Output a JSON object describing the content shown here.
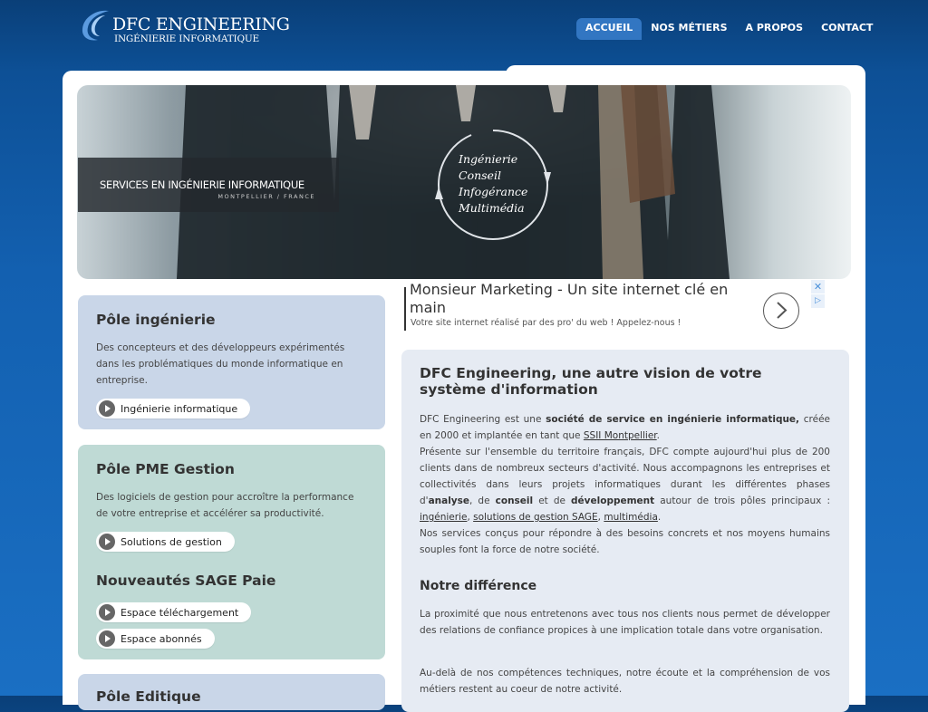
{
  "header": {
    "brand": "DFC ENGINEERING",
    "tagline": "INGÉNIERIE INFORMATIQUE",
    "nav": [
      "ACCUEIL",
      "NOS MÉTIERS",
      "A PROPOS",
      "CONTACT"
    ]
  },
  "banner": {
    "caption_main": "SERVICES EN INGÉNIERIE INFORMATIQUE",
    "caption_sub": "MONTPELLIER / FRANCE",
    "circle_words": [
      "Ingénierie",
      "Conseil",
      "Infogérance",
      "Multimédia"
    ]
  },
  "poles": {
    "ingenierie": {
      "title": "Pôle ingénierie",
      "desc": "Des concepteurs et des développeurs expérimentés dans les problématiques du monde informatique en entreprise.",
      "link": "Ingénierie informatique"
    },
    "pme": {
      "title": "Pôle PME Gestion",
      "desc": "Des logiciels de gestion pour accroître la performance de votre entreprise et accélérer sa productivité.",
      "link": "Solutions de gestion",
      "sage_title": "Nouveautés SAGE Paie",
      "sage_links": [
        "Espace téléchargement",
        "Espace abonnés"
      ]
    },
    "editique": {
      "title": "Pôle Editique"
    }
  },
  "ad": {
    "title": "Monsieur Marketing - Un site internet clé en main",
    "text": "Votre site internet réalisé par des pro' du web ! Appelez-nous !",
    "close": "✕",
    "adchoices": "▷"
  },
  "main": {
    "title": "DFC Engineering, une autre vision de votre système d'information",
    "p1": {
      "a": "DFC Engineering est une ",
      "b": "société de service en ingénierie informatique,",
      "c": " créée en 2000 et implantée en tant que ",
      "link": "SSII Montpellier",
      "d": "."
    },
    "p2": {
      "a": "Présente sur l'ensemble du territoire français, DFC compte aujourd'hui plus de 200 clients dans de nombreux secteurs d'activité. Nous accompagnons les entreprises et collectivités dans leurs projets informatiques durant les différentes phases d'",
      "b": "analyse",
      "c": ", de ",
      "d": "conseil",
      "e": " et de ",
      "f": "développement",
      "g": " autour de trois pôles principaux : ",
      "l1": "ingénierie",
      "s1": ", ",
      "l2": "solutions de gestion SAGE",
      "s2": ", ",
      "l3": "multimédia",
      "h": "."
    },
    "p3": "Nos services conçus pour répondre à des besoins concrets et nos moyens humains souples font la force de notre société.",
    "h2": "Notre différence",
    "p4": "La proximité que nous entretenons avec tous nos clients nous permet de développer des relations de confiance propices à une implication totale dans votre organisation.",
    "p5": "Au-delà de nos compétences techniques, notre écoute et la compréhension de vos métiers restent au coeur de notre activité."
  },
  "colors": {
    "pole_ingenierie_bg": "#c9d6e8",
    "pole_pme_bg": "#bfdad5",
    "pole_editique_bg": "#c9d6e8",
    "content_bg": "#e6ebf3",
    "nav_active_bg": "#3276c2"
  }
}
